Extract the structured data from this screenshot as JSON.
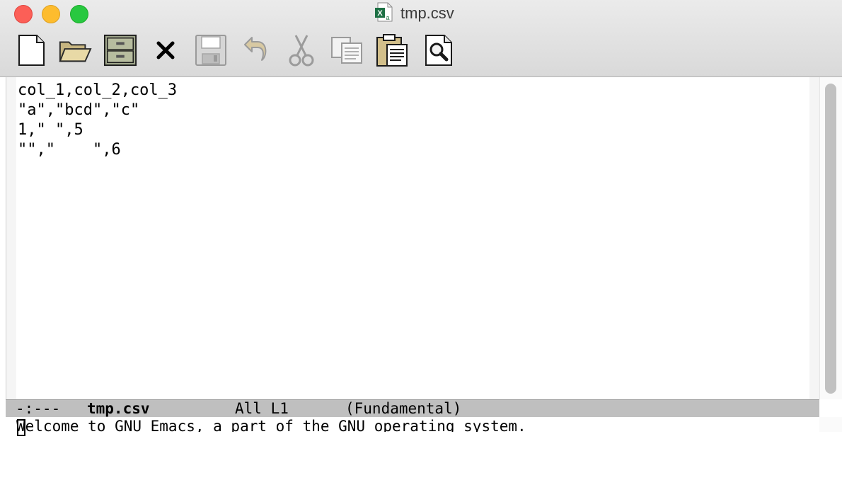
{
  "window": {
    "title": "tmp.csv",
    "file_icon": "excel-file-icon"
  },
  "toolbar": [
    {
      "name": "new-file-button",
      "icon": "new-file-icon"
    },
    {
      "name": "open-file-button",
      "icon": "folder-open-icon"
    },
    {
      "name": "open-directory-button",
      "icon": "file-cabinet-icon"
    },
    {
      "name": "close-buffer-button",
      "icon": "close-icon"
    },
    {
      "name": "save-button",
      "icon": "floppy-disk-icon",
      "disabled": true
    },
    {
      "name": "undo-button",
      "icon": "undo-icon",
      "disabled": true
    },
    {
      "name": "cut-button",
      "icon": "scissors-icon",
      "disabled": true
    },
    {
      "name": "copy-button",
      "icon": "copy-icon",
      "disabled": true
    },
    {
      "name": "paste-button",
      "icon": "clipboard-icon"
    },
    {
      "name": "search-button",
      "icon": "search-icon"
    }
  ],
  "buffer": {
    "lines": [
      "col_1,col_2,col_3",
      "\"a\",\"bcd\",\"c\"",
      "1,\" \",5",
      "\"\",\"    \",6"
    ]
  },
  "modeline": {
    "status": "-:---",
    "buffer_name": "tmp.csv",
    "position": "All L1",
    "mode": "(Fundamental)"
  },
  "echo_area": {
    "message": "Welcome to GNU Emacs, a part of the GNU operating system."
  },
  "colors": {
    "close": "#fc5f57",
    "minimize": "#fdbc2e",
    "maximize": "#28c840",
    "modeline_bg": "#bfbfbf",
    "excel_green": "#1d7044"
  }
}
